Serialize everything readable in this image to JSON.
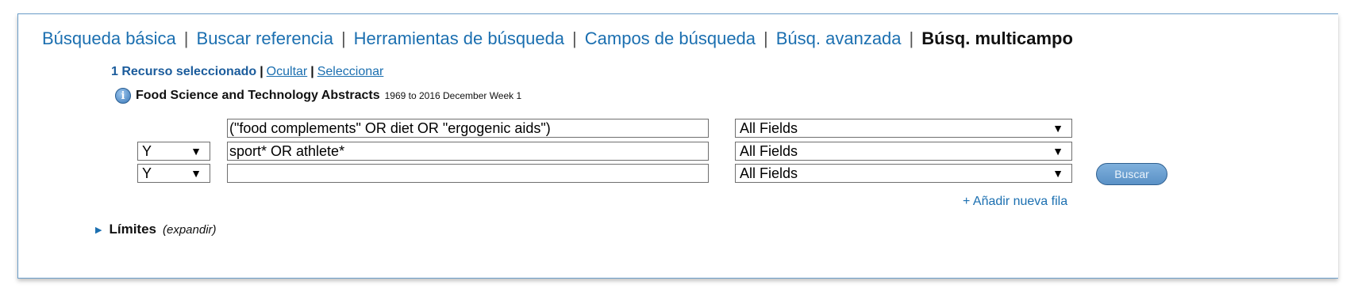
{
  "tabs": [
    {
      "label": "Búsqueda básica",
      "active": false
    },
    {
      "label": "Buscar referencia",
      "active": false
    },
    {
      "label": "Herramientas de búsqueda",
      "active": false
    },
    {
      "label": "Campos de búsqueda",
      "active": false
    },
    {
      "label": "Búsq. avanzada",
      "active": false
    },
    {
      "label": "Búsq. multicampo",
      "active": true
    }
  ],
  "resources": {
    "selected_text": "1 Recurso seleccionado",
    "hide_link": "Ocultar",
    "select_link": "Seleccionar",
    "database_name": "Food Science and Technology Abstracts",
    "database_range": "1969 to 2016 December Week 1",
    "info_icon": "info-icon"
  },
  "search_rows": [
    {
      "operator": "",
      "term": "(\"food complements\" OR diet OR \"ergogenic aids\")",
      "field": "All Fields"
    },
    {
      "operator": "Y",
      "term": "sport* OR athlete*",
      "field": "All Fields"
    },
    {
      "operator": "Y",
      "term": "",
      "field": "All Fields"
    }
  ],
  "dropdown_arrow": "▼",
  "search_button": "Buscar",
  "add_row": "+ Añadir nueva fila",
  "limits": {
    "label": "Límites",
    "toggle": "(expandir)"
  },
  "colors": {
    "link": "#1b6fb0",
    "border": "#6a9dc9",
    "button": "#5a91c6"
  }
}
